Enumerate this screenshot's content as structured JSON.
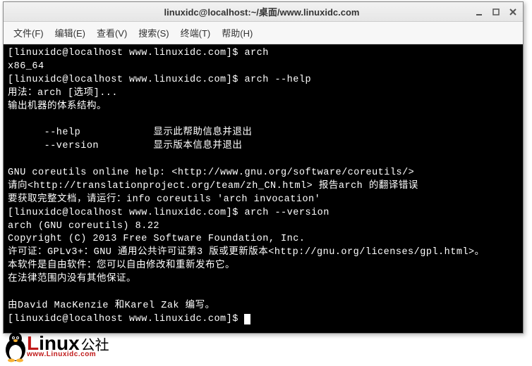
{
  "window": {
    "title": "linuxidc@localhost:~/桌面/www.linuxidc.com"
  },
  "menu": {
    "file": "文件(F)",
    "edit": "编辑(E)",
    "view": "查看(V)",
    "search": "搜索(S)",
    "terminal": "终端(T)",
    "help": "帮助(H)"
  },
  "terminal": {
    "lines": [
      "[linuxidc@localhost www.linuxidc.com]$ arch",
      "x86_64",
      "[linuxidc@localhost www.linuxidc.com]$ arch --help",
      "用法：arch [选项]...",
      "输出机器的体系结构。",
      "",
      "      --help            显示此帮助信息并退出",
      "      --version         显示版本信息并退出",
      "",
      "GNU coreutils online help: <http://www.gnu.org/software/coreutils/>",
      "请向<http://translationproject.org/team/zh_CN.html> 报告arch 的翻译错误",
      "要获取完整文档，请运行：info coreutils 'arch invocation'",
      "[linuxidc@localhost www.linuxidc.com]$ arch --version",
      "arch (GNU coreutils) 8.22",
      "Copyright (C) 2013 Free Software Foundation, Inc.",
      "许可证：GPLv3+：GNU 通用公共许可证第3 版或更新版本<http://gnu.org/licenses/gpl.html>。",
      "本软件是自由软件：您可以自由修改和重新发布它。",
      "在法律范围内没有其他保证。",
      "",
      "由David MacKenzie 和Karel Zak 编写。",
      "[linuxidc@localhost www.linuxidc.com]$ "
    ]
  },
  "logo": {
    "main_prefix": "L",
    "main_rest": "inux",
    "suffix": "公社",
    "url": "www.Linuxidc.com"
  }
}
